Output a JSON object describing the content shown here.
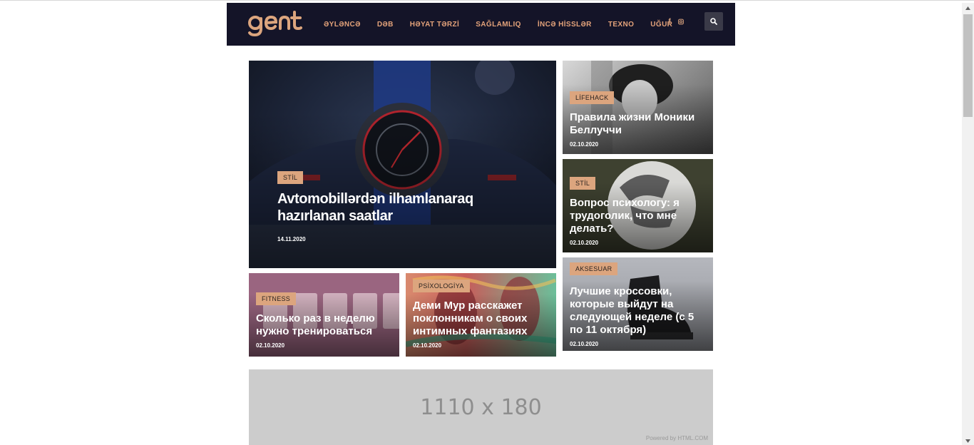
{
  "header": {
    "logo_text": "gent",
    "nav": [
      "ƏYLƏNCƏ",
      "DƏB",
      "HƏYAT TƏRZİ",
      "SAĞLAMLIQ",
      "İNCƏ HİSSLƏR",
      "TEXNO",
      "UĞUR"
    ],
    "social": [
      "f",
      "instagram-icon"
    ],
    "search_icon": "search-icon"
  },
  "featured": {
    "category": "STİL",
    "title": "Avtomobillərdən ilhamlanaraq hazırlanan saatlar",
    "date": "14.11.2020"
  },
  "side_cards": [
    {
      "category": "LİFEHACK",
      "title": "Правила жизни Моники Беллуччи",
      "date": "02.10.2020"
    },
    {
      "category": "STİL",
      "title": "Вопрос психологу: я трудоголик, что мне делать?",
      "date": "02.10.2020"
    },
    {
      "category": "AKSESUAR",
      "title": "Лучшие кроссовки, которые выйдут на следующей неделе (с 5 по 11 октября)",
      "date": "02.10.2020"
    }
  ],
  "bottom_cards": [
    {
      "category": "FITNESS",
      "title": "Сколько раз в неделю нужно тренироваться",
      "date": "02.10.2020"
    },
    {
      "category": "PSİXOLOGİYA",
      "title": "Деми Мур расскажет поклонникам о своих интимных фантазиях",
      "date": "02.10.2020"
    }
  ],
  "ad": {
    "size_text": "1110 x 180",
    "powered_text": "Powered by HTML.COM"
  },
  "colors": {
    "header_bg": "#141428",
    "accent": "#dca57e",
    "nav_text": "#e3a27a"
  }
}
